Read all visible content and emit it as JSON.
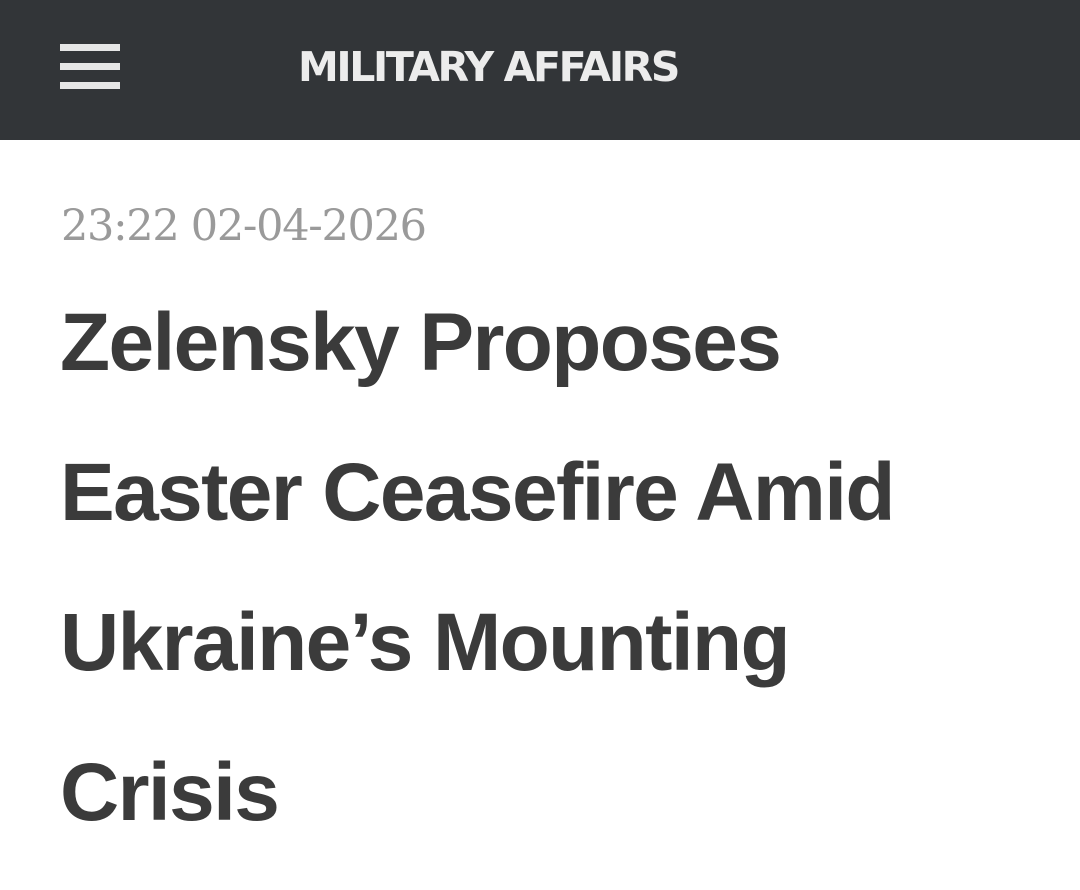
{
  "header": {
    "site_name": "MILITARY AFFAIRS",
    "menu_icon": "hamburger-menu-icon"
  },
  "article": {
    "timestamp": "23:22 02-04-2026",
    "headline_lines": [
      "Zelensky Proposes",
      "Easter Ceasefire Amid",
      "Ukraine’s Mounting",
      "Crisis"
    ]
  },
  "colors": {
    "header_background": "#323538",
    "header_text": "#ececec",
    "timestamp_text": "#9a9a9a",
    "headline_text": "#3b3b3b",
    "page_background": "#ffffff"
  }
}
